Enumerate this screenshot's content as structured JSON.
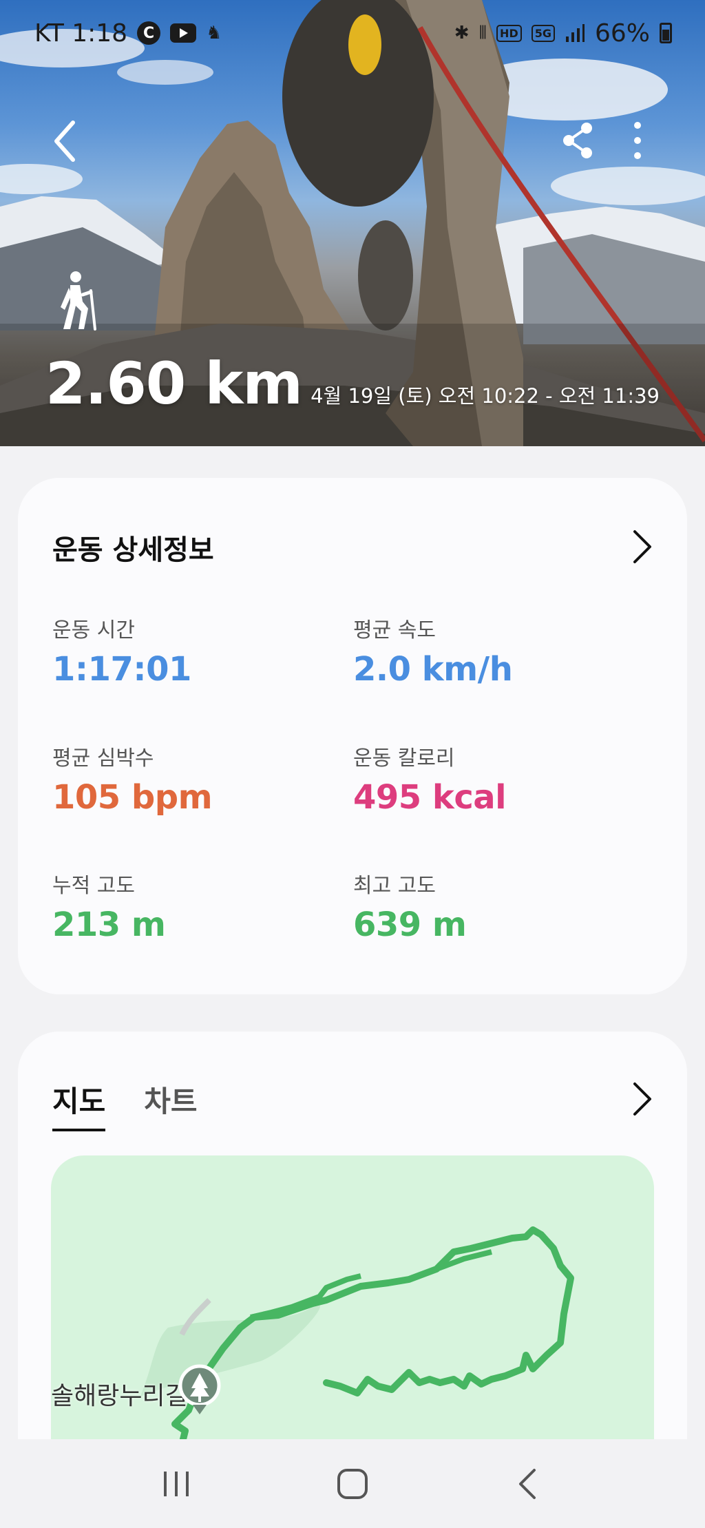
{
  "status_bar": {
    "carrier_time": "KT 1:18",
    "c_badge": "C",
    "hd_label": "HD",
    "net_label": "5G",
    "battery": "66%",
    "icons": [
      "youtube-icon",
      "notification-icon",
      "bluetooth-icon",
      "vibrate-icon",
      "signal-icon",
      "battery-icon"
    ]
  },
  "header": {
    "icons": [
      "back-icon",
      "share-icon",
      "more-icon"
    ]
  },
  "hero": {
    "activity_icon": "hiking-icon",
    "distance": "2.60 km",
    "time_range": "4월 19일 (토) 오전 10:22 - 오전 11:39"
  },
  "details": {
    "title": "운동 상세정보",
    "metrics": [
      {
        "label": "운동 시간",
        "value": "1:17:01",
        "color": "#4a8ee0"
      },
      {
        "label": "평균 속도",
        "value": "2.0 km/h",
        "color": "#4a8ee0"
      },
      {
        "label": "평균 심박수",
        "value": "105 bpm",
        "color": "#e0683c"
      },
      {
        "label": "운동 칼로리",
        "value": "495 kcal",
        "color": "#dd3d7e"
      },
      {
        "label": "누적 고도",
        "value": "213 m",
        "color": "#47b662"
      },
      {
        "label": "최고 고도",
        "value": "639 m",
        "color": "#47b662"
      }
    ]
  },
  "map_section": {
    "tabs": [
      {
        "label": "지도",
        "active": true
      },
      {
        "label": "차트",
        "active": false
      }
    ],
    "place_label": "솔해랑누리길",
    "route_color": "#47b662",
    "map_bg": "#d7f4dd"
  },
  "nav": {
    "icons": [
      "recent-apps-icon",
      "home-icon",
      "back-nav-icon"
    ]
  }
}
